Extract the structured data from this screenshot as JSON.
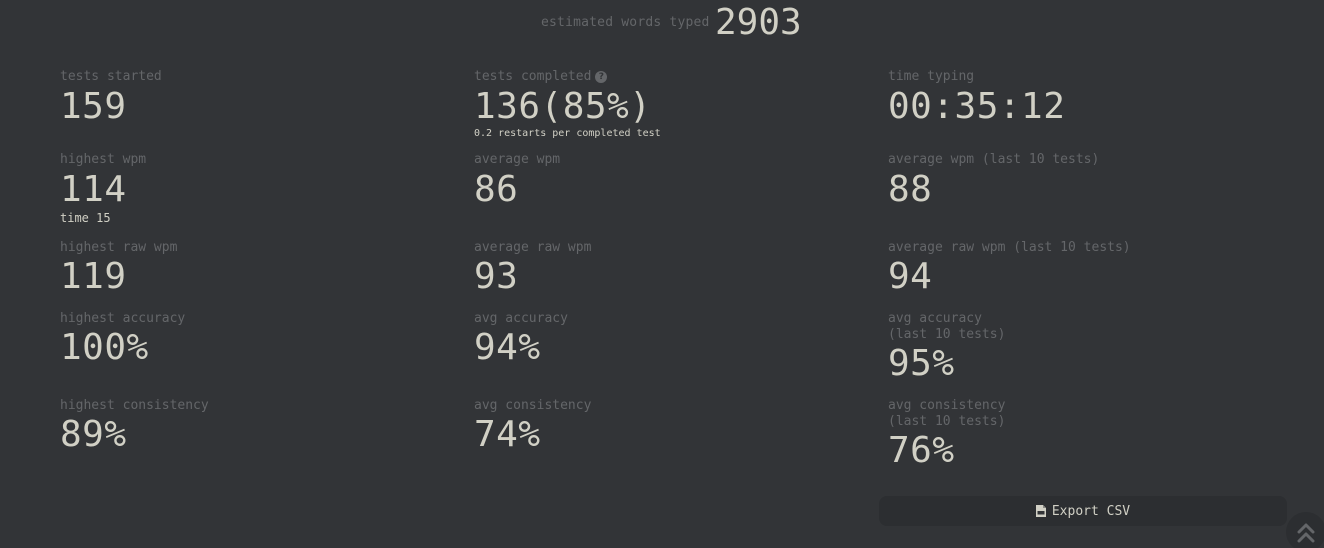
{
  "header": {
    "words_label": "estimated words typed",
    "words_value": "2903"
  },
  "stats": {
    "tests_started": {
      "label": "tests started",
      "value": "159"
    },
    "tests_completed": {
      "label": "tests completed",
      "value": "136(85%)",
      "note": "0.2 restarts per completed test"
    },
    "time_typing": {
      "label": "time typing",
      "value": "00:35:12"
    },
    "highest_wpm": {
      "label": "highest wpm",
      "value": "114",
      "note": "time 15"
    },
    "average_wpm": {
      "label": "average wpm",
      "value": "86"
    },
    "average_wpm_last10": {
      "label": "average wpm (last 10 tests)",
      "value": "88"
    },
    "highest_raw_wpm": {
      "label": "highest raw wpm",
      "value": "119"
    },
    "average_raw_wpm": {
      "label": "average raw wpm",
      "value": "93"
    },
    "average_raw_wpm_last10": {
      "label": "average raw wpm (last 10 tests)",
      "value": "94"
    },
    "highest_accuracy": {
      "label": "highest accuracy",
      "value": "100%"
    },
    "avg_accuracy": {
      "label": "avg accuracy",
      "value": "94%"
    },
    "avg_accuracy_last10": {
      "label_line1": "avg accuracy",
      "label_line2": "(last 10 tests)",
      "value": "95%"
    },
    "highest_consistency": {
      "label": "highest consistency",
      "value": "89%"
    },
    "avg_consistency": {
      "label": "avg consistency",
      "value": "74%"
    },
    "avg_consistency_last10": {
      "label_line1": "avg consistency",
      "label_line2": "(last 10 tests)",
      "value": "76%"
    }
  },
  "actions": {
    "export_label": "Export CSV",
    "export_icon": "file-csv-icon",
    "scroll_icon": "double-chevron-up-icon"
  },
  "colors": {
    "background": "#323437",
    "text": "#d1d0c5",
    "sub_text": "#646669",
    "button_bg": "#2c2e31"
  }
}
